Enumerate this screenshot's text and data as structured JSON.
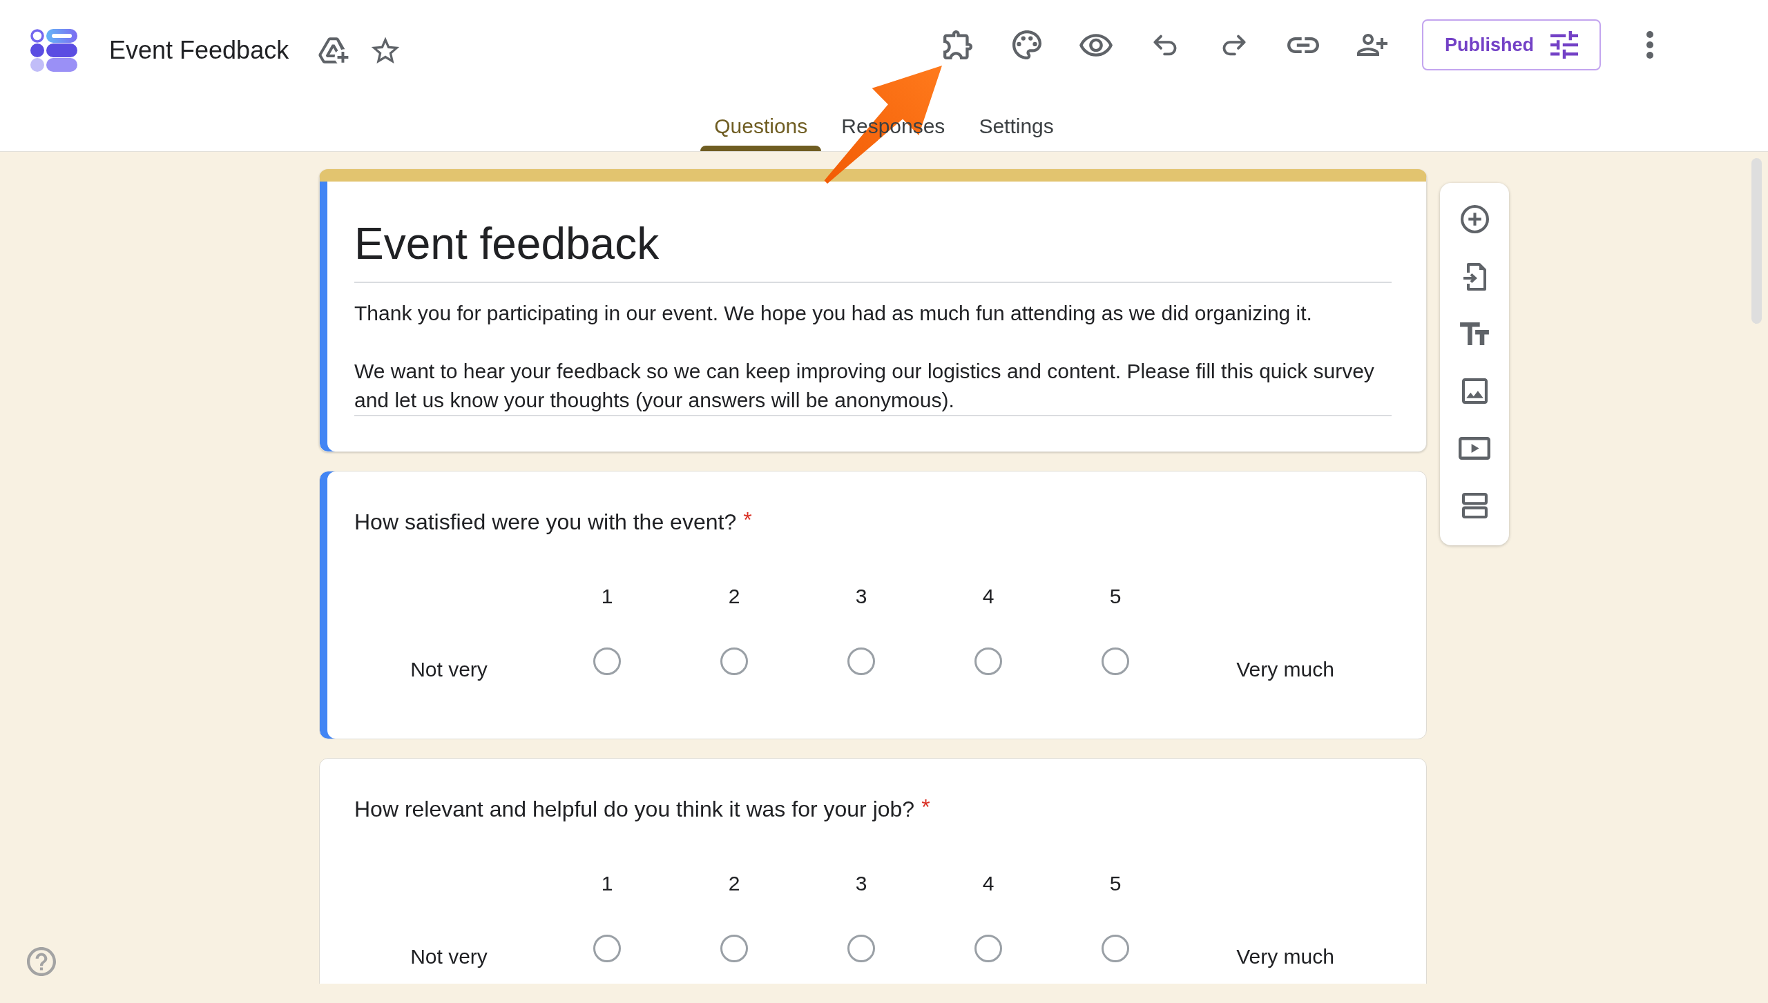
{
  "header": {
    "title": "Event Feedback",
    "publish_button": "Published"
  },
  "tabs": [
    {
      "label": "Questions",
      "selected": true
    },
    {
      "label": "Responses",
      "selected": false
    },
    {
      "label": "Settings",
      "selected": false
    }
  ],
  "form_header": {
    "selected": true,
    "title": "Event feedback",
    "description": "Thank you for participating in our event. We hope you had as much fun attending as we did organizing it.\n\nWe want to hear your feedback so we can keep improving our logistics and content. Please fill this quick survey and let us know your thoughts (your answers will be anonymous)."
  },
  "questions": [
    {
      "kind": "linear_scale",
      "selected": true,
      "text": "How satisfied were you with the event?",
      "required_mark": "*",
      "low_label": "Not very",
      "high_label": "Very much",
      "points": [
        {
          "label": "1",
          "selected": false
        },
        {
          "label": "2",
          "selected": false
        },
        {
          "label": "3",
          "selected": false
        },
        {
          "label": "4",
          "selected": false
        },
        {
          "label": "5",
          "selected": false
        }
      ]
    },
    {
      "kind": "linear_scale",
      "selected": false,
      "text": "How relevant and helpful do you think it was for your job?",
      "required_mark": "*",
      "low_label": "Not very",
      "high_label": "Very much",
      "points": [
        {
          "label": "1",
          "selected": false
        },
        {
          "label": "2",
          "selected": false
        },
        {
          "label": "3",
          "selected": false
        },
        {
          "label": "4",
          "selected": false
        },
        {
          "label": "5",
          "selected": false
        }
      ]
    }
  ],
  "annotations": [
    {
      "kind": "arrow"
    }
  ]
}
